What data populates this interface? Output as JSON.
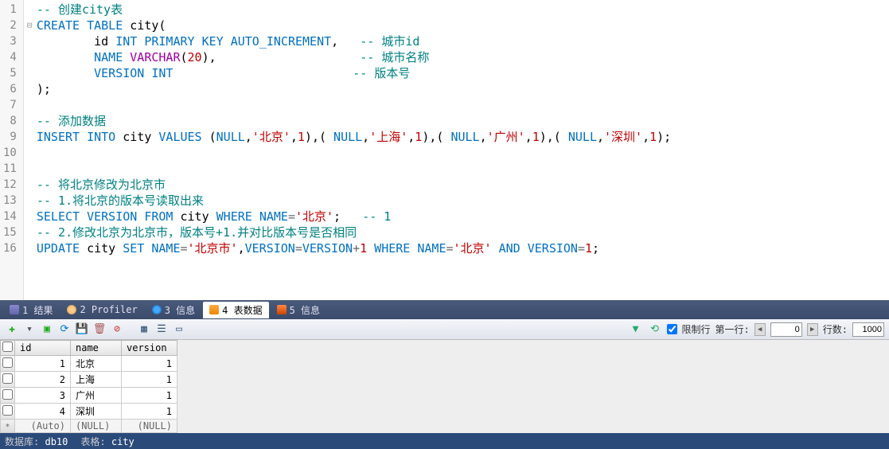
{
  "editor": {
    "lines": [
      {
        "n": 1,
        "fold": "",
        "tokens": [
          {
            "t": "-- 创建city表",
            "c": "cmt"
          }
        ]
      },
      {
        "n": 2,
        "fold": "⊟",
        "tokens": [
          {
            "t": "CREATE",
            "c": "kw"
          },
          {
            "t": " ",
            "c": ""
          },
          {
            "t": "TABLE",
            "c": "kw"
          },
          {
            "t": " city(",
            "c": "id"
          }
        ]
      },
      {
        "n": 3,
        "fold": "",
        "tokens": [
          {
            "t": "        id ",
            "c": "id"
          },
          {
            "t": "INT",
            "c": "kw"
          },
          {
            "t": " ",
            "c": ""
          },
          {
            "t": "PRIMARY",
            "c": "kw"
          },
          {
            "t": " ",
            "c": ""
          },
          {
            "t": "KEY",
            "c": "kw"
          },
          {
            "t": " ",
            "c": ""
          },
          {
            "t": "AUTO_INCREMENT",
            "c": "kw"
          },
          {
            "t": ",   ",
            "c": "id"
          },
          {
            "t": "-- 城市id",
            "c": "cmt"
          }
        ]
      },
      {
        "n": 4,
        "fold": "",
        "tokens": [
          {
            "t": "        ",
            "c": ""
          },
          {
            "t": "NAME",
            "c": "kw"
          },
          {
            "t": " ",
            "c": ""
          },
          {
            "t": "VARCHAR",
            "c": "fn"
          },
          {
            "t": "(",
            "c": "id"
          },
          {
            "t": "20",
            "c": "num"
          },
          {
            "t": "),                    ",
            "c": "id"
          },
          {
            "t": "-- 城市名称",
            "c": "cmt"
          }
        ]
      },
      {
        "n": 5,
        "fold": "",
        "tokens": [
          {
            "t": "        ",
            "c": ""
          },
          {
            "t": "VERSION",
            "c": "kw"
          },
          {
            "t": " ",
            "c": ""
          },
          {
            "t": "INT",
            "c": "kw"
          },
          {
            "t": "                         ",
            "c": ""
          },
          {
            "t": "-- 版本号",
            "c": "cmt"
          }
        ]
      },
      {
        "n": 6,
        "fold": "",
        "tokens": [
          {
            "t": ");",
            "c": "id"
          }
        ]
      },
      {
        "n": 7,
        "fold": "",
        "tokens": []
      },
      {
        "n": 8,
        "fold": "",
        "tokens": [
          {
            "t": "-- 添加数据",
            "c": "cmt"
          }
        ]
      },
      {
        "n": 9,
        "fold": "",
        "tokens": [
          {
            "t": "INSERT",
            "c": "kw"
          },
          {
            "t": " ",
            "c": ""
          },
          {
            "t": "INTO",
            "c": "kw"
          },
          {
            "t": " city ",
            "c": "id"
          },
          {
            "t": "VALUES",
            "c": "kw"
          },
          {
            "t": " (",
            "c": "id"
          },
          {
            "t": "NULL",
            "c": "kw"
          },
          {
            "t": ",",
            "c": "id"
          },
          {
            "t": "'北京'",
            "c": "str"
          },
          {
            "t": ",",
            "c": "id"
          },
          {
            "t": "1",
            "c": "num"
          },
          {
            "t": "),( ",
            "c": "id"
          },
          {
            "t": "NULL",
            "c": "kw"
          },
          {
            "t": ",",
            "c": "id"
          },
          {
            "t": "'上海'",
            "c": "str"
          },
          {
            "t": ",",
            "c": "id"
          },
          {
            "t": "1",
            "c": "num"
          },
          {
            "t": "),( ",
            "c": "id"
          },
          {
            "t": "NULL",
            "c": "kw"
          },
          {
            "t": ",",
            "c": "id"
          },
          {
            "t": "'广州'",
            "c": "str"
          },
          {
            "t": ",",
            "c": "id"
          },
          {
            "t": "1",
            "c": "num"
          },
          {
            "t": "),( ",
            "c": "id"
          },
          {
            "t": "NULL",
            "c": "kw"
          },
          {
            "t": ",",
            "c": "id"
          },
          {
            "t": "'深圳'",
            "c": "str"
          },
          {
            "t": ",",
            "c": "id"
          },
          {
            "t": "1",
            "c": "num"
          },
          {
            "t": ");",
            "c": "id"
          }
        ]
      },
      {
        "n": 10,
        "fold": "",
        "tokens": []
      },
      {
        "n": 11,
        "fold": "",
        "tokens": []
      },
      {
        "n": 12,
        "fold": "",
        "tokens": [
          {
            "t": "-- 将北京修改为北京市",
            "c": "cmt"
          }
        ]
      },
      {
        "n": 13,
        "fold": "",
        "tokens": [
          {
            "t": "-- 1.将北京的版本号读取出来",
            "c": "cmt"
          }
        ]
      },
      {
        "n": 14,
        "fold": "",
        "tokens": [
          {
            "t": "SELECT",
            "c": "kw"
          },
          {
            "t": " ",
            "c": ""
          },
          {
            "t": "VERSION",
            "c": "kw"
          },
          {
            "t": " ",
            "c": ""
          },
          {
            "t": "FROM",
            "c": "kw"
          },
          {
            "t": " city ",
            "c": "id"
          },
          {
            "t": "WHERE",
            "c": "kw"
          },
          {
            "t": " ",
            "c": ""
          },
          {
            "t": "NAME",
            "c": "kw"
          },
          {
            "t": "=",
            "c": "op"
          },
          {
            "t": "'北京'",
            "c": "str"
          },
          {
            "t": ";   ",
            "c": "id"
          },
          {
            "t": "-- 1",
            "c": "cmt"
          }
        ]
      },
      {
        "n": 15,
        "fold": "",
        "tokens": [
          {
            "t": "-- 2.修改北京为北京市，版本号+1.并对比版本号是否相同",
            "c": "cmt"
          }
        ]
      },
      {
        "n": 16,
        "fold": "",
        "tokens": [
          {
            "t": "UPDATE",
            "c": "kw"
          },
          {
            "t": " city ",
            "c": "id"
          },
          {
            "t": "SET",
            "c": "kw"
          },
          {
            "t": " ",
            "c": ""
          },
          {
            "t": "NAME",
            "c": "kw"
          },
          {
            "t": "=",
            "c": "op"
          },
          {
            "t": "'北京市'",
            "c": "str"
          },
          {
            "t": ",",
            "c": "id"
          },
          {
            "t": "VERSION",
            "c": "kw"
          },
          {
            "t": "=",
            "c": "op"
          },
          {
            "t": "VERSION",
            "c": "kw"
          },
          {
            "t": "+",
            "c": "op"
          },
          {
            "t": "1",
            "c": "num"
          },
          {
            "t": " ",
            "c": ""
          },
          {
            "t": "WHERE",
            "c": "kw"
          },
          {
            "t": " ",
            "c": ""
          },
          {
            "t": "NAME",
            "c": "kw"
          },
          {
            "t": "=",
            "c": "op"
          },
          {
            "t": "'北京'",
            "c": "str"
          },
          {
            "t": " ",
            "c": ""
          },
          {
            "t": "AND",
            "c": "kw"
          },
          {
            "t": " ",
            "c": ""
          },
          {
            "t": "VERSION",
            "c": "kw"
          },
          {
            "t": "=",
            "c": "op"
          },
          {
            "t": "1",
            "c": "num"
          },
          {
            "t": ";",
            "c": "id"
          }
        ]
      }
    ]
  },
  "tabs": {
    "items": [
      {
        "label": "1 结果",
        "icon": "ico-grid"
      },
      {
        "label": "2 Profiler",
        "icon": "ico-user"
      },
      {
        "label": "3 信息",
        "icon": "ico-info"
      },
      {
        "label": "4 表数据",
        "icon": "ico-table"
      },
      {
        "label": "5 信息",
        "icon": "ico-info2"
      }
    ],
    "activeIndex": 3
  },
  "toolbar": {
    "limit_label": "限制行",
    "firstrow_label": "第一行:",
    "firstrow_value": "0",
    "rowcount_label": "行数:",
    "rowcount_value": "1000"
  },
  "grid": {
    "columns": [
      "id",
      "name",
      "version"
    ],
    "rows": [
      {
        "id": "1",
        "name": "北京",
        "version": "1"
      },
      {
        "id": "2",
        "name": "上海",
        "version": "1"
      },
      {
        "id": "3",
        "name": "广州",
        "version": "1"
      },
      {
        "id": "4",
        "name": "深圳",
        "version": "1"
      }
    ],
    "newrow": {
      "id": "(Auto)",
      "name": "(NULL)",
      "version": "(NULL)"
    }
  },
  "status": {
    "db_label": "数据库:",
    "db_value": "db10",
    "table_label": "表格:",
    "table_value": "city"
  }
}
